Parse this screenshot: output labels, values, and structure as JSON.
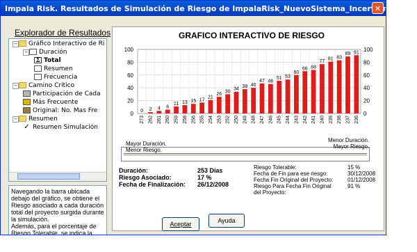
{
  "window": {
    "title": "Impala Risk.  Resultados de Simulación de Riesgo de ImpalaRisk_NuevoSistema_Incertidmbre.mpp",
    "close_glyph": "✕"
  },
  "explorer": {
    "title": "Explorador de Resultados",
    "items": [
      {
        "label": "Gráfico Interactivo de Ri"
      },
      {
        "label": "Duración"
      },
      {
        "label": "Total"
      },
      {
        "label": "Resumen"
      },
      {
        "label": "Frecuencia"
      },
      {
        "label": "Camino Crítico"
      },
      {
        "label": "Participación de Cada"
      },
      {
        "label": "Más Frecuente"
      },
      {
        "label": "Original: No.  Mas Fre"
      },
      {
        "label": "Resumen"
      },
      {
        "label": "Resumen Simulación"
      }
    ]
  },
  "info_text": "Navegando la barra ubicada debajo del gráfico, se obtiene el Riesgo asociado a cada duración total del proyecto surgida durante la simulación.\nAdemás, para el porcentaje de Riesgo Tolerable, se indica la fecha",
  "chart_data": {
    "type": "bar",
    "title": "GRAFICO INTERACTIVO DE RIESGO",
    "categories": [
      "273",
      "262",
      "261",
      "260",
      "259",
      "258",
      "256",
      "255",
      "254",
      "253",
      "252",
      "250",
      "249",
      "248",
      "247",
      "246",
      "245",
      "244",
      "243",
      "242",
      "241",
      "240",
      "239",
      "238",
      "237",
      "236"
    ],
    "values": [
      0,
      2,
      4,
      6,
      11,
      13,
      15,
      17,
      21,
      26,
      30,
      34,
      38,
      40,
      47,
      46,
      51,
      53,
      60,
      66,
      68,
      77,
      81,
      83,
      89,
      91
    ],
    "ylim": [
      0,
      100
    ],
    "y_ticks": [
      0,
      20,
      40,
      60,
      80,
      100
    ],
    "bar_color": "#dd1c1c",
    "grid": true
  },
  "slider": {
    "left_label": "Mayor Duración.\nMenor Riesgo.",
    "right_label": "Menor Duración.\nMayor Riesgo."
  },
  "results": {
    "duration_label": "Duración:",
    "duration_value": "253 Días",
    "risk_label": "Riesgo Asociado:",
    "risk_value": "17 %",
    "end_label": "Fecha de Finalización:",
    "end_value": "26/12/2008"
  },
  "tolerable": {
    "risk_label": "Riesgo Tolerable:",
    "risk_value": "15 %",
    "end_label": "Fecha de Fin para ese riesgo:",
    "end_value": "30/12/2008",
    "orig_end_label": "Fecha Fin Original del Proyecto:",
    "orig_end_value": "01/12/2008",
    "orig_risk_label": "Riesgo Para Fecha Fin Original\ndel Proyecto:",
    "orig_risk_value": "91 %"
  },
  "buttons": {
    "accept": "Aceptar",
    "help": "Ayuda"
  }
}
